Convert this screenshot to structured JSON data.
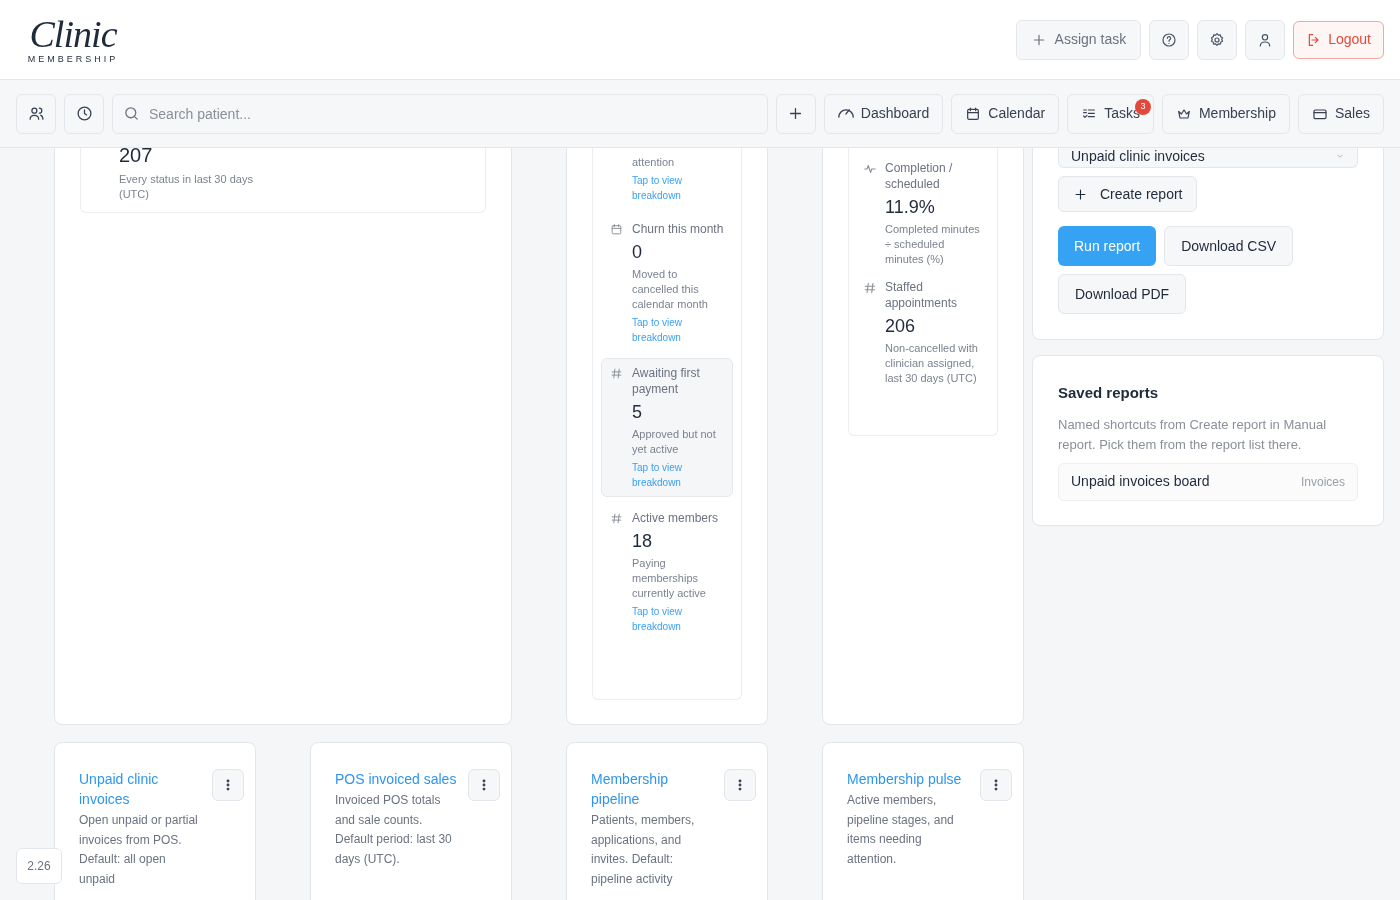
{
  "header": {
    "logo": {
      "title": "Clinic",
      "subtitle": "MEMBERSHIP"
    },
    "actions": [
      {
        "kind": "assign",
        "label": "Assign task"
      },
      {
        "kind": "help"
      },
      {
        "kind": "settings"
      },
      {
        "kind": "profile"
      },
      {
        "kind": "logout",
        "label": "Logout"
      }
    ]
  },
  "toolbar": {
    "quick": [
      {
        "kind": "patients"
      },
      {
        "kind": "history"
      }
    ],
    "search": {
      "placeholder": "Search patient..."
    },
    "nav": [
      {
        "kind": "add"
      },
      {
        "kind": "dashboard",
        "label": "Dashboard"
      },
      {
        "kind": "calendar",
        "label": "Calendar"
      },
      {
        "kind": "tasks",
        "label": "Tasks",
        "badge": "3"
      },
      {
        "kind": "membership",
        "label": "Membership"
      },
      {
        "kind": "sales",
        "label": "Sales"
      }
    ]
  },
  "overview_card": {
    "value": "207",
    "caption": "Every status in last 30 days (UTC)"
  },
  "member_metrics": [
    {
      "kind": "tail",
      "caption": "attention",
      "link": "Tap to view breakdown",
      "highlighted": false
    },
    {
      "kind": "calendar",
      "label": "Churn this month",
      "value": "0",
      "caption": "Moved to cancelled this calendar month",
      "link": "Tap to view breakdown",
      "highlighted": false
    },
    {
      "kind": "hash",
      "label": "Awaiting first payment",
      "value": "5",
      "caption": "Approved but not yet active",
      "link": "Tap to view breakdown",
      "highlighted": true
    },
    {
      "kind": "hash",
      "label": "Active members",
      "value": "18",
      "caption": "Paying memberships currently active",
      "link": "Tap to view breakdown",
      "highlighted": false
    }
  ],
  "appointment_metrics": [
    {
      "kind": "pulse",
      "label": "Completion / scheduled",
      "value": "11.9%",
      "caption": "Completed minutes ÷ scheduled minutes (%)"
    },
    {
      "kind": "hash",
      "label": "Staffed appointments",
      "value": "206",
      "caption": "Non-cancelled with clinician assigned, last 30 days (UTC)"
    }
  ],
  "reports_panel": {
    "report_select": "Unpaid clinic invoices",
    "actions": [
      {
        "kind": "create",
        "label": "Create report"
      },
      {
        "kind": "primary",
        "label": "Run report"
      },
      {
        "kind": "secondary",
        "label": "Download CSV"
      },
      {
        "kind": "secondary",
        "label": "Download PDF"
      }
    ]
  },
  "saved_reports": {
    "title": "Saved reports",
    "description": "Named shortcuts from Create report in Manual report. Pick them from the report list there.",
    "items": [
      {
        "name": "Unpaid invoices board",
        "category": "Invoices"
      }
    ]
  },
  "report_cards": [
    {
      "title": "Unpaid clinic invoices",
      "description": "Open unpaid or partial invoices from POS. Default: all open unpaid"
    },
    {
      "title": "POS invoiced sales",
      "description": "Invoiced POS totals and sale counts. Default period: last 30 days (UTC)."
    },
    {
      "title": "Membership pipeline",
      "description": "Patients, members, applications, and invites. Default: pipeline activity"
    },
    {
      "title": "Membership pulse",
      "description": "Active members, pipeline stages, and items needing attention."
    }
  ],
  "version": "2.26"
}
